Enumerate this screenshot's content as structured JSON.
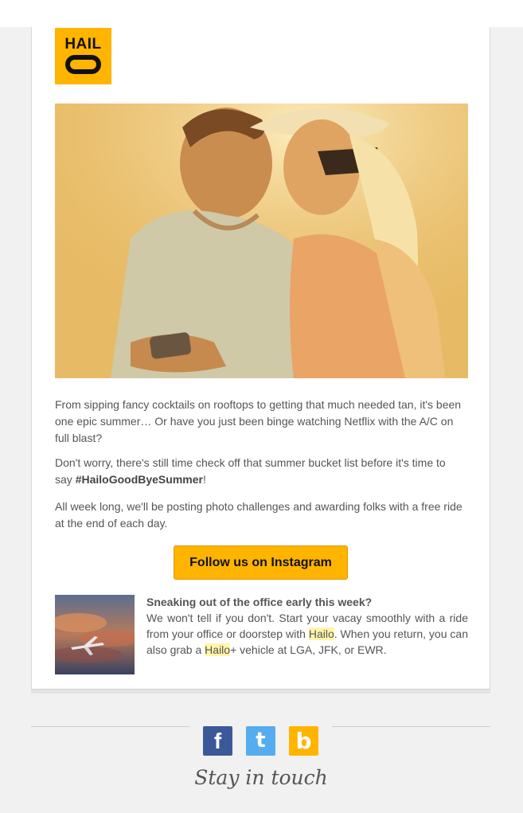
{
  "brand": {
    "logo_text": "HAIL",
    "color": "#ffb400"
  },
  "intro": {
    "p1": "From sipping fancy cocktails on rooftops to getting that much needed tan, it's been one epic summer… Or have you just been binge watching Netflix with the A/C on full blast?",
    "p2_before": "Don't worry, there's still time check off that summer bucket list before it's time to say ",
    "p2_hashtag": "#HailoGoodByeSummer",
    "p2_after": "!",
    "p3": "All week long, we'll be posting photo challenges and awarding folks with a free ride at the end of each day."
  },
  "cta": {
    "label": "Follow us on Instagram"
  },
  "promo": {
    "heading": "Sneaking out of the office early this week?",
    "text_1": "We won't tell if you don't. Start your vacay smoothly with a ride from your office or doorstep with ",
    "brand_1": "Hailo",
    "text_2": ". When you return, you can also grab a ",
    "brand_2": "Hailo",
    "text_3": "+ vehicle at LGA, JFK, or EWR."
  },
  "footer": {
    "facebook_glyph": "f",
    "twitter_glyph": "t",
    "blog_glyph": "b",
    "tagline": "Stay in touch",
    "facebook_color": "#3b5998",
    "twitter_color": "#55acee",
    "blog_color": "#ffb400"
  }
}
